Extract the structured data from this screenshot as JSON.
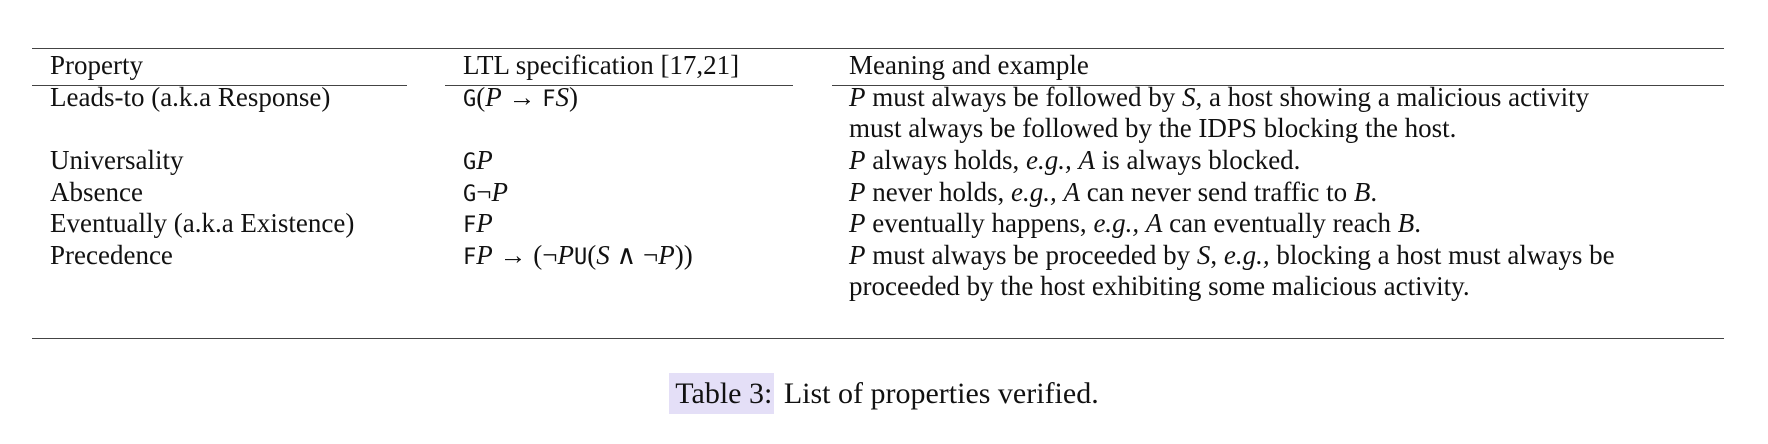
{
  "table": {
    "headers": [
      "Property",
      "LTL specification [17,21]",
      "Meaning and example"
    ],
    "rows": [
      {
        "property": "Leads-to (a.k.a Response)",
        "ltl": "G(P → FS)",
        "meaning_line1": "P must always be followed by S, a host showing a malicious activity",
        "meaning_line2": "must always be followed by the IDPS blocking the host."
      },
      {
        "property": "Universality",
        "ltl": "GP",
        "meaning": "P always holds, e.g., A is always blocked."
      },
      {
        "property": "Absence",
        "ltl": "G¬P",
        "meaning": "P never holds, e.g., A can never send traffic to B."
      },
      {
        "property": "Eventually (a.k.a Existence)",
        "ltl": "FP",
        "meaning": "P eventually happens, e.g., A can eventually reach B."
      },
      {
        "property": "Precedence",
        "ltl": "FP → (¬PU(S ∧ ¬P))",
        "meaning_line1": "P must always be proceeded by S, e.g., blocking a host must always be",
        "meaning_line2": "proceeded by the host exhibiting some malicious activity."
      }
    ]
  },
  "caption": {
    "label": "Table 3:",
    "text": "List of properties verified."
  }
}
